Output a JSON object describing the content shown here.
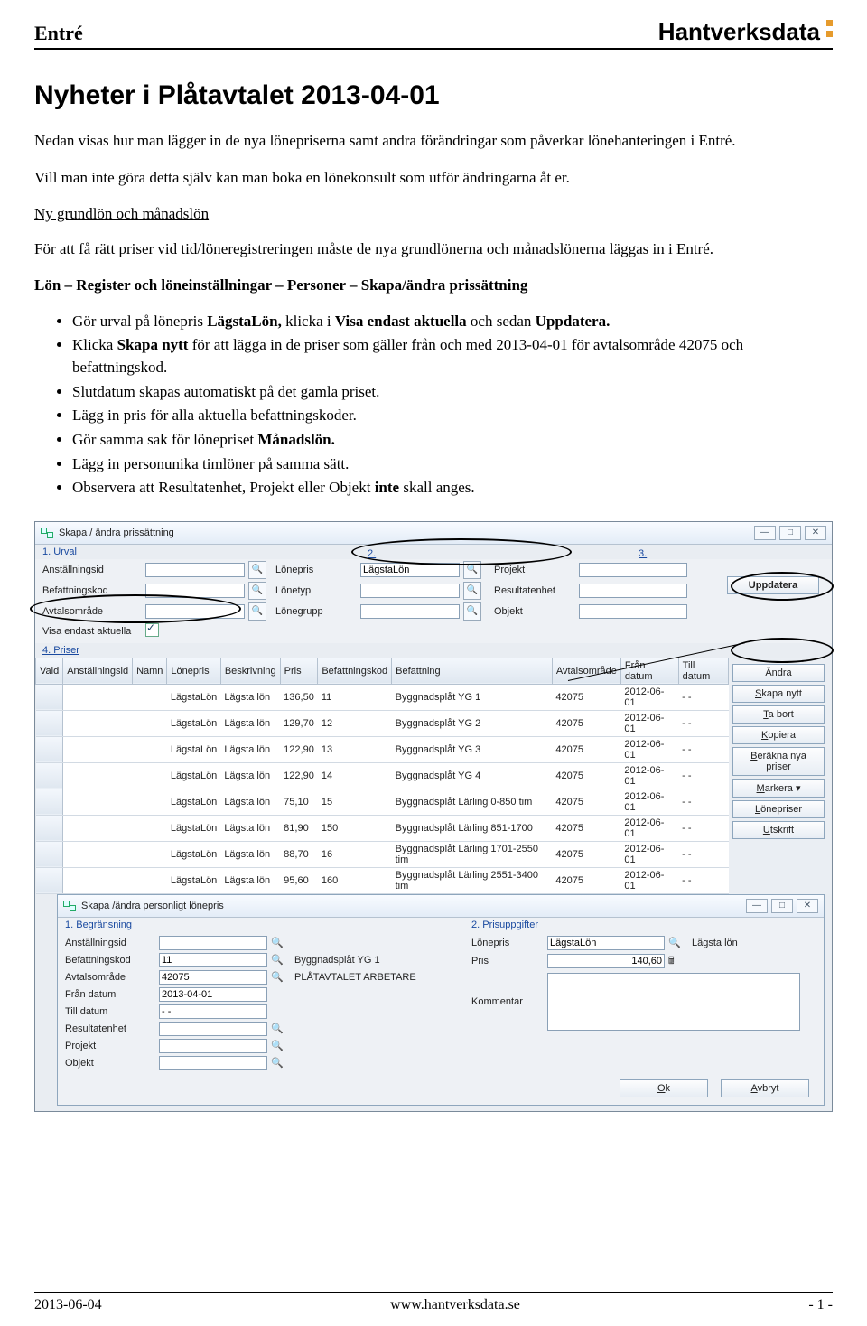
{
  "header": {
    "left": "Entré",
    "right": "Hantverksdata"
  },
  "title": "Nyheter i Plåtavtalet 2013-04-01",
  "intro1": "Nedan visas hur man lägger in de nya lönepriserna samt andra förändringar som påverkar lönehanteringen i Entré.",
  "intro2": "Vill man inte göra detta själv kan man boka en lönekonsult som utför ändringarna åt er.",
  "subhead": "Ny grundlön och månadslön",
  "para2": "För att få rätt priser vid tid/löneregistreringen måste de nya grundlönerna och månadslönerna läggas in i Entré.",
  "navpath": "Lön – Register och löneinställningar – Personer – Skapa/ändra prissättning",
  "bullets": [
    "Gör urval på lönepris <b>LägstaLön,</b> klicka i <b>Visa endast aktuella</b> och sedan <b>Uppdatera.</b>",
    "Klicka <b>Skapa nytt</b> för att lägga in de priser som gäller från och med 2013-04-01 för avtalsområde 42075 och befattningskod.",
    "Slutdatum skapas automatiskt på det gamla priset.",
    "Lägg in pris för alla aktuella befattningskoder.",
    "Gör samma sak för lönepriset <b>Månadslön.</b>",
    "Lägg in personunika timlöner på samma sätt.",
    "Observera att Resultatenhet, Projekt eller Objekt <b>inte</b> skall anges."
  ],
  "app": {
    "win1_title": "Skapa / ändra prissättning",
    "sections": {
      "urval": "1. Urval",
      "s2": "2.",
      "s3": "3.",
      "priser": "4. Priser"
    },
    "urval_labels": {
      "anst": "Anställningsid",
      "bef": "Befattningskod",
      "avtal": "Avtalsområde",
      "visa": "Visa endast aktuella",
      "lonepris": "Lönepris",
      "lonetyp": "Lönetyp",
      "lonegrupp": "Lönegrupp",
      "projekt": "Projekt",
      "resultat": "Resultatenhet",
      "objekt": "Objekt"
    },
    "urval_values": {
      "lonepris": "LägstaLön"
    },
    "uppdatera": "Uppdatera",
    "columns": [
      "Vald",
      "Anställningsid",
      "Namn",
      "Lönepris",
      "Beskrivning",
      "Pris",
      "Befattningskod",
      "Befattning",
      "Avtalsområde",
      "Från datum",
      "Till datum"
    ],
    "rows": [
      [
        "",
        "",
        "",
        "LägstaLön",
        "Lägsta lön",
        "136,50",
        "11",
        "Byggnadsplåt YG 1",
        "42075",
        "2012-06-01",
        "- -"
      ],
      [
        "",
        "",
        "",
        "LägstaLön",
        "Lägsta lön",
        "129,70",
        "12",
        "Byggnadsplåt YG 2",
        "42075",
        "2012-06-01",
        "- -"
      ],
      [
        "",
        "",
        "",
        "LägstaLön",
        "Lägsta lön",
        "122,90",
        "13",
        "Byggnadsplåt YG 3",
        "42075",
        "2012-06-01",
        "- -"
      ],
      [
        "",
        "",
        "",
        "LägstaLön",
        "Lägsta lön",
        "122,90",
        "14",
        "Byggnadsplåt YG 4",
        "42075",
        "2012-06-01",
        "- -"
      ],
      [
        "",
        "",
        "",
        "LägstaLön",
        "Lägsta lön",
        "75,10",
        "15",
        "Byggnadsplåt Lärling 0-850 tim",
        "42075",
        "2012-06-01",
        "- -"
      ],
      [
        "",
        "",
        "",
        "LägstaLön",
        "Lägsta lön",
        "81,90",
        "150",
        "Byggnadsplåt Lärling 851-1700",
        "42075",
        "2012-06-01",
        "- -"
      ],
      [
        "",
        "",
        "",
        "LägstaLön",
        "Lägsta lön",
        "88,70",
        "16",
        "Byggnadsplåt Lärling 1701-2550 tim",
        "42075",
        "2012-06-01",
        "- -"
      ],
      [
        "",
        "",
        "",
        "LägstaLön",
        "Lägsta lön",
        "95,60",
        "160",
        "Byggnadsplåt Lärling 2551-3400 tim",
        "42075",
        "2012-06-01",
        "- -"
      ]
    ],
    "sidebuttons": [
      "Ändra",
      "Skapa nytt",
      "Ta bort",
      "Kopiera",
      "Beräkna nya priser",
      "Markera",
      "Lönepriser",
      "Utskrift"
    ],
    "win2_title": "Skapa /ändra personligt lönepris",
    "win2_sections": {
      "begr": "1. Begränsning",
      "pris": "2. Prisuppgifter"
    },
    "begr_labels": {
      "anst": "Anställningsid",
      "bef": "Befattningskod",
      "avtal": "Avtalsområde",
      "fran": "Från datum",
      "till": "Till datum",
      "res": "Resultatenhet",
      "proj": "Projekt",
      "obj": "Objekt"
    },
    "begr_values": {
      "bef": "11",
      "bef_desc": "Byggnadsplåt YG 1",
      "avtal": "42075",
      "avtal_desc": "PLÅTAVTALET ARBETARE",
      "fran": "2013-04-01",
      "till": "- -"
    },
    "pris_labels": {
      "lonepris": "Lönepris",
      "pris": "Pris",
      "kommentar": "Kommentar"
    },
    "pris_values": {
      "lonepris": "LägstaLön",
      "lonepris_desc": "Lägsta lön",
      "pris": "140,60"
    },
    "ok": "Ok",
    "avbryt": "Avbryt"
  },
  "footer": {
    "date": "2013-06-04",
    "url": "www.hantverksdata.se",
    "page": "- 1 -"
  }
}
